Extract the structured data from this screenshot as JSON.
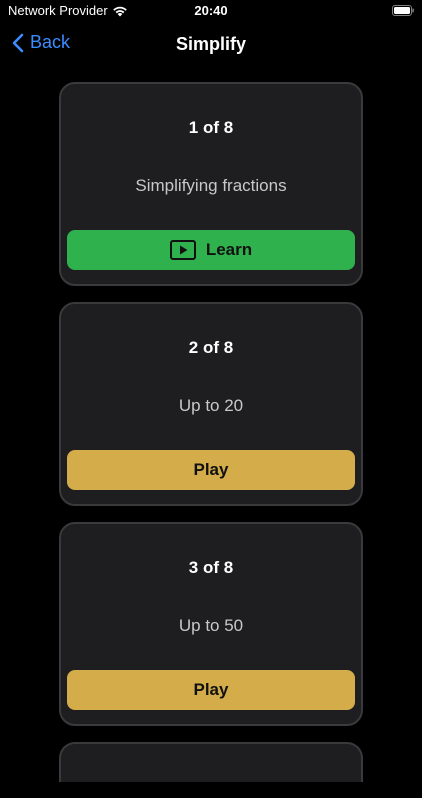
{
  "status_bar": {
    "carrier": "Network Provider",
    "time": "20:40"
  },
  "nav": {
    "back_label": "Back",
    "title": "Simplify"
  },
  "levels": [
    {
      "count": "1 of 8",
      "description": "Simplifying fractions",
      "button_label": "Learn"
    },
    {
      "count": "2 of 8",
      "description": "Up to 20",
      "button_label": "Play"
    },
    {
      "count": "3 of 8",
      "description": "Up to 50",
      "button_label": "Play"
    }
  ],
  "colors": {
    "background": "#000000",
    "card": "#1e1e20",
    "card_border": "#3a3a3c",
    "learn_button": "#2fb14d",
    "play_button": "#d4ad4a",
    "link_blue": "#3a8cff"
  }
}
